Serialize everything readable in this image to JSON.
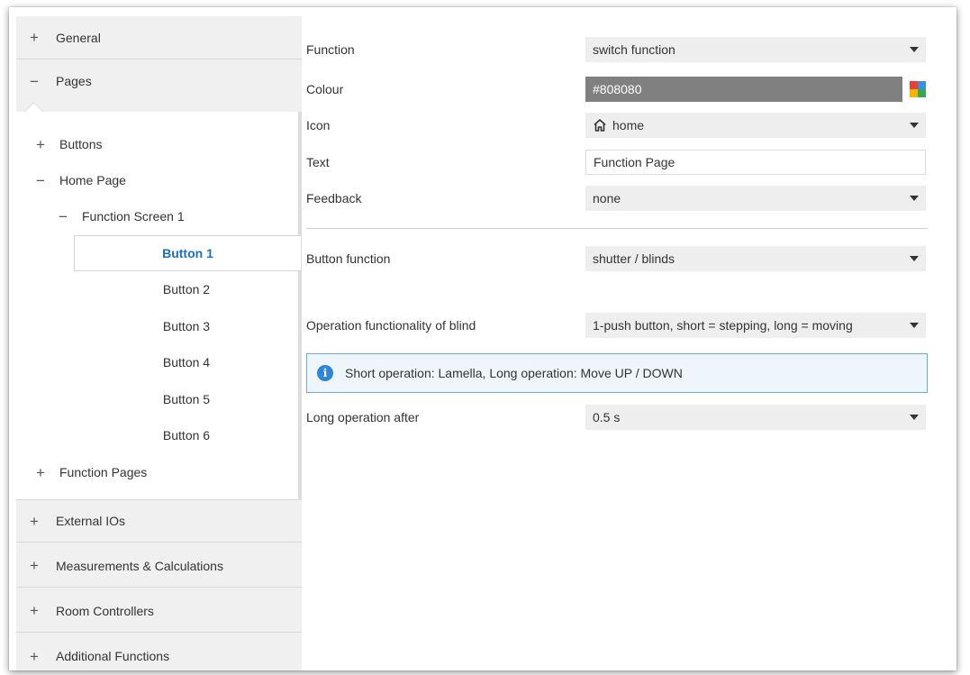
{
  "sidebar": {
    "sections": {
      "general": {
        "sign": "+",
        "label": "General"
      },
      "pages": {
        "sign": "−",
        "label": "Pages"
      },
      "external_ios": {
        "sign": "+",
        "label": "External IOs"
      },
      "measurements": {
        "sign": "+",
        "label": "Measurements & Calculations"
      },
      "room_controllers": {
        "sign": "+",
        "label": "Room Controllers"
      },
      "additional_functions": {
        "sign": "+",
        "label": "Additional Functions"
      }
    },
    "pages_tree": {
      "buttons": {
        "sign": "+",
        "label": "Buttons"
      },
      "home_page": {
        "sign": "−",
        "label": "Home Page"
      },
      "function_screen": {
        "sign": "−",
        "label": "Function Screen 1"
      },
      "button_items": [
        "Button 1",
        "Button 2",
        "Button 3",
        "Button 4",
        "Button 5",
        "Button 6"
      ],
      "function_pages": {
        "sign": "+",
        "label": "Function Pages"
      }
    }
  },
  "form": {
    "function": {
      "label": "Function",
      "value": "switch function"
    },
    "colour": {
      "label": "Colour",
      "value": "#808080",
      "swatch": "#808080"
    },
    "icon": {
      "label": "Icon",
      "value": "home",
      "icon_name": "home-icon"
    },
    "text": {
      "label": "Text",
      "value": "Function Page"
    },
    "feedback": {
      "label": "Feedback",
      "value": "none"
    },
    "button_function": {
      "label": "Button function",
      "value": "shutter / blinds"
    },
    "operation": {
      "label": "Operation functionality of blind",
      "value": "1-push button, short = stepping, long = moving"
    },
    "info": {
      "text": "Short operation: Lamella, Long operation: Move UP / DOWN",
      "icon_name": "info-icon"
    },
    "long_operation": {
      "label": "Long operation after",
      "value": "0.5 s"
    }
  },
  "colors": {
    "accent": "#1a6fc0",
    "info_border": "#6fa8dc",
    "info_icon": "#2f86d9",
    "palette": [
      "#e8413c",
      "#3b8fe0",
      "#f4b400",
      "#3aa655"
    ]
  }
}
